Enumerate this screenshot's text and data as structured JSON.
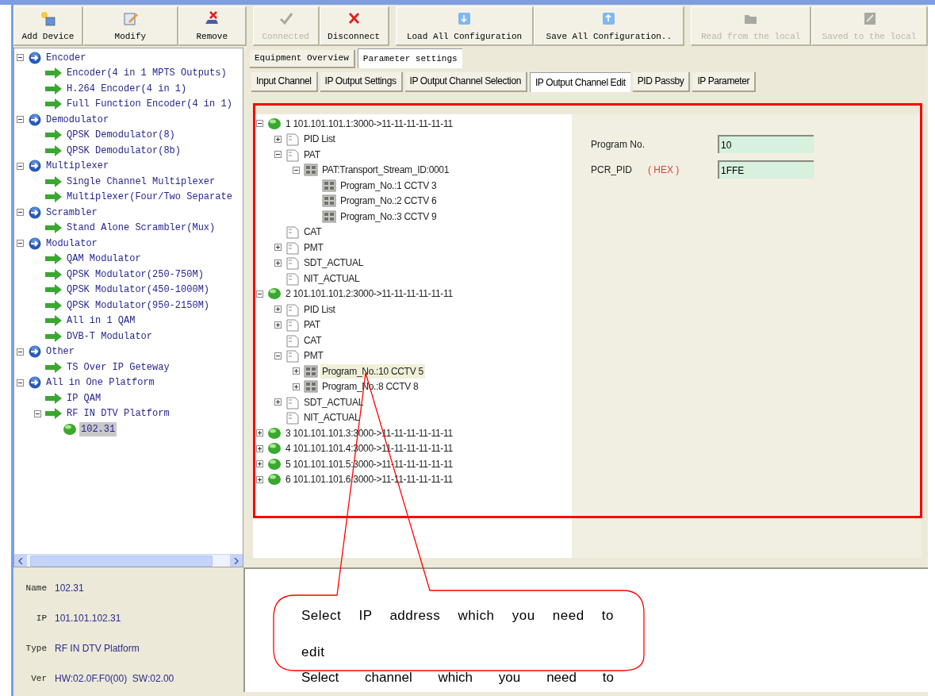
{
  "toolbar": [
    {
      "label": "Add Device",
      "disabled": false
    },
    {
      "label": "Modify",
      "disabled": false
    },
    {
      "label": "Remove",
      "disabled": false
    },
    {
      "label": "Connected",
      "disabled": true
    },
    {
      "label": "Disconnect",
      "disabled": false
    },
    {
      "label": "Load All Configuration",
      "disabled": false
    },
    {
      "label": "Save All Configuration..",
      "disabled": false
    },
    {
      "label": "Read from the local",
      "disabled": true
    },
    {
      "label": "Saved to the local",
      "disabled": true
    }
  ],
  "device_tree": [
    {
      "kind": "category",
      "label": "Encoder",
      "expanded": true,
      "selected": false,
      "children": [
        {
          "kind": "device",
          "label": "Encoder(4 in 1 MPTS Outputs)",
          "selected": false
        },
        {
          "kind": "device",
          "label": "H.264 Encoder(4 in 1)",
          "selected": false
        },
        {
          "kind": "device",
          "label": "Full Function Encoder(4 in 1)",
          "selected": false
        }
      ]
    },
    {
      "kind": "category",
      "label": "Demodulator",
      "expanded": true,
      "selected": false,
      "children": [
        {
          "kind": "device",
          "label": "QPSK Demodulator(8)",
          "selected": false
        },
        {
          "kind": "device",
          "label": "QPSK Demodulator(8b)",
          "selected": false
        }
      ]
    },
    {
      "kind": "category",
      "label": "Multiplexer",
      "expanded": true,
      "selected": false,
      "children": [
        {
          "kind": "device",
          "label": "Single Channel Multiplexer",
          "selected": false
        },
        {
          "kind": "device",
          "label": "Multiplexer(Four/Two Separate",
          "selected": false
        }
      ]
    },
    {
      "kind": "category",
      "label": "Scrambler",
      "expanded": true,
      "selected": false,
      "children": [
        {
          "kind": "device",
          "label": "Stand Alone Scrambler(Mux)",
          "selected": false
        }
      ]
    },
    {
      "kind": "category",
      "label": "Modulator",
      "expanded": true,
      "selected": false,
      "children": [
        {
          "kind": "device",
          "label": "QAM Modulator",
          "selected": false
        },
        {
          "kind": "device",
          "label": "QPSK Modulator(250-750M)",
          "selected": false
        },
        {
          "kind": "device",
          "label": "QPSK Modulator(450-1000M)",
          "selected": false
        },
        {
          "kind": "device",
          "label": "QPSK Modulator(950-2150M)",
          "selected": false
        },
        {
          "kind": "device",
          "label": "All in 1 QAM",
          "selected": false
        },
        {
          "kind": "device",
          "label": "DVB-T Modulator",
          "selected": false
        }
      ]
    },
    {
      "kind": "category",
      "label": "Other",
      "expanded": true,
      "selected": false,
      "children": [
        {
          "kind": "device",
          "label": "TS Over IP Geteway",
          "selected": false
        }
      ]
    },
    {
      "kind": "category",
      "label": "All in One Platform",
      "expanded": true,
      "selected": false,
      "children": [
        {
          "kind": "device",
          "label": "IP QAM",
          "selected": false
        },
        {
          "kind": "device",
          "label": "RF IN DTV Platform",
          "expanded": true,
          "selected": false,
          "children": [
            {
              "kind": "node",
              "label": "102.31",
              "selected": true
            }
          ]
        }
      ]
    }
  ],
  "tabs": [
    {
      "label": "Equipment Overview",
      "selected": false
    },
    {
      "label": "Parameter settings",
      "selected": true
    }
  ],
  "subtabs": [
    {
      "label": "Input Channel",
      "selected": false
    },
    {
      "label": "IP Output Settings",
      "selected": false
    },
    {
      "label": "IP Output Channel Selection",
      "selected": false
    },
    {
      "label": "IP Output Channel Edit",
      "selected": true
    },
    {
      "label": "PID Passby",
      "selected": false
    },
    {
      "label": "IP Parameter",
      "selected": false
    }
  ],
  "channel_tree": [
    {
      "kind": "stream",
      "label": "1 101.101.101.1:3000->11-11-11-11-11-11",
      "expanded": true,
      "selected": false,
      "children": [
        {
          "kind": "folder",
          "label": "PID List",
          "expanded": false,
          "selected": false
        },
        {
          "kind": "folder",
          "label": "PAT",
          "expanded": true,
          "selected": false,
          "children": [
            {
              "kind": "table",
              "label": "PAT:Transport_Stream_ID:0001",
              "expanded": true,
              "selected": false,
              "children": [
                {
                  "kind": "table",
                  "label": "Program_No.:1 CCTV 3",
                  "selected": false
                },
                {
                  "kind": "table",
                  "label": "Program_No.:2 CCTV 6",
                  "selected": false
                },
                {
                  "kind": "table",
                  "label": "Program_No.:3 CCTV 9",
                  "selected": false
                }
              ]
            }
          ]
        },
        {
          "kind": "folder",
          "label": "CAT",
          "selected": false
        },
        {
          "kind": "folder",
          "label": "PMT",
          "expanded": false,
          "selected": false
        },
        {
          "kind": "folder",
          "label": "SDT_ACTUAL",
          "expanded": false,
          "selected": false
        },
        {
          "kind": "folder",
          "label": "NIT_ACTUAL",
          "selected": false
        }
      ]
    },
    {
      "kind": "stream",
      "label": "2 101.101.101.2:3000->11-11-11-11-11-11",
      "expanded": true,
      "selected": false,
      "children": [
        {
          "kind": "folder",
          "label": "PID List",
          "expanded": false,
          "selected": false
        },
        {
          "kind": "folder",
          "label": "PAT",
          "expanded": false,
          "selected": false
        },
        {
          "kind": "folder",
          "label": "CAT",
          "selected": false
        },
        {
          "kind": "folder",
          "label": "PMT",
          "expanded": true,
          "selected": false,
          "children": [
            {
              "kind": "table",
              "label": "Program_No.:10 CCTV 5",
              "expanded": false,
              "selected": true
            },
            {
              "kind": "table",
              "label": "Program_No.:8 CCTV 8",
              "expanded": false,
              "selected": false
            }
          ]
        },
        {
          "kind": "folder",
          "label": "SDT_ACTUAL",
          "expanded": false,
          "selected": false
        },
        {
          "kind": "folder",
          "label": "NIT_ACTUAL",
          "selected": false
        }
      ]
    },
    {
      "kind": "stream",
      "label": "3 101.101.101.3:3000->11-11-11-11-11-11",
      "expanded": false,
      "selected": false
    },
    {
      "kind": "stream",
      "label": "4 101.101.101.4:3000->11-11-11-11-11-11",
      "expanded": false,
      "selected": false
    },
    {
      "kind": "stream",
      "label": "5 101.101.101.5:3000->11-11-11-11-11-11",
      "expanded": false,
      "selected": false
    },
    {
      "kind": "stream",
      "label": "6 101.101.101.6:3000->11-11-11-11-11-11",
      "expanded": false,
      "selected": false
    }
  ],
  "form": {
    "program_no": {
      "label": "Program No.",
      "value": "10"
    },
    "pcr_pid": {
      "label": "PCR_PID",
      "unit": "( HEX )",
      "value": "1FFE"
    }
  },
  "device_info": [
    {
      "label": "Name",
      "value": "102.31"
    },
    {
      "label": "IP",
      "value": "101.101.102.31"
    },
    {
      "label": "Type",
      "value": "RF IN DTV Platform"
    },
    {
      "label": "Ver",
      "value": "HW:02.0F.F0(00)  SW:02.00"
    }
  ],
  "annotation": {
    "callout": "Select IP address which you need to edit",
    "caption": "Select channel which you need to"
  }
}
